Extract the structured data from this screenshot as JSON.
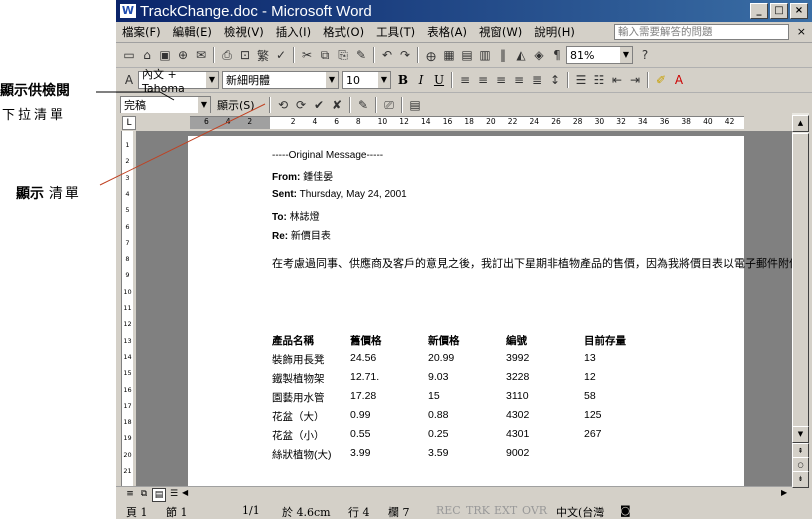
{
  "callouts": {
    "first_label": "顯示供檢閱",
    "first_sub": "下拉清單",
    "second_label": "顯示",
    "second_sub": "清單"
  },
  "window": {
    "title": "TrackChange.doc - Microsoft Word",
    "controls": [
      "_",
      "□",
      "×"
    ]
  },
  "menu": {
    "items": [
      "檔案(F)",
      "編輯(E)",
      "檢視(V)",
      "插入(I)",
      "格式(O)",
      "工具(T)",
      "表格(A)",
      "視窗(W)",
      "說明(H)"
    ],
    "help_placeholder": "輸入需要解答的問題",
    "close": "×"
  },
  "toolbar_standard": {
    "zoom": "81%",
    "icons": [
      "new-icon",
      "open-icon",
      "save-icon",
      "permission-icon",
      "email-icon",
      "print-icon",
      "print-preview-icon",
      "research-icon",
      "spelling-icon",
      "cut-icon",
      "copy-icon",
      "paste-icon",
      "format-painter-icon",
      "undo-icon",
      "redo-icon",
      "hyperlink-icon",
      "tables-icon",
      "insert-table-icon",
      "insert-excel-icon",
      "columns-icon",
      "drawing-icon",
      "document-map-icon",
      "show-hide-icon",
      "help-icon"
    ]
  },
  "toolbar_format": {
    "style": "內文 + Tahoma",
    "font": "新細明體",
    "size": "10",
    "bold": "B",
    "italic": "I",
    "underline": "U"
  },
  "toolbar_review": {
    "display": "完稿",
    "show_label": "顯示(S)"
  },
  "ruler": {
    "numbers": [
      "6",
      "4",
      "2",
      "",
      "2",
      "4",
      "6",
      "8",
      "10",
      "12",
      "14",
      "16",
      "18",
      "20",
      "22",
      "24",
      "26",
      "28",
      "30",
      "32",
      "34",
      "36",
      "38",
      "40",
      "42"
    ]
  },
  "vertical_ruler": {
    "numbers": [
      "1",
      "2",
      "3",
      "4",
      "5",
      "6",
      "7",
      "8",
      "9",
      "10",
      "11",
      "12",
      "13",
      "14",
      "15",
      "16",
      "17",
      "18",
      "19",
      "20",
      "21"
    ]
  },
  "document": {
    "original_message": "-----Original Message-----",
    "from_label": "From:",
    "from_value": "鍾佳晏",
    "sent_label": "Sent:",
    "sent_value": "Thursday, May 24, 2001",
    "to_label": "To:",
    "to_value": "林誌燈",
    "re_label": "Re:",
    "re_value": "新價目表",
    "body": "在考慮過同事、供應商及客戶的意見之後，我訂出下星期非植物產品的售價，因為我將價目表以電子郵件附件寄給您，我想也可以把產品說明及市場價格趨勢表寄給您",
    "table": {
      "headers": [
        "產品名稱",
        "舊價格",
        "新價格",
        "編號",
        "目前存量"
      ],
      "rows": [
        [
          "裝飾用長凳",
          "24.56",
          "20.99",
          "3992",
          "13"
        ],
        [
          "鐵製植物架",
          "12.71.",
          "9.03",
          "3228",
          "12"
        ],
        [
          "園藝用水管",
          "17.28",
          "15",
          "3110",
          "58"
        ],
        [
          "花盆（大）",
          "0.99",
          "0.88",
          "4302",
          "125"
        ],
        [
          "花盆（小）",
          "0.55",
          "0.25",
          "4301",
          "267"
        ],
        [
          "絲狀植物(大)",
          "3.99",
          "3.59",
          "9002",
          ""
        ]
      ]
    }
  },
  "statusbar": {
    "page": "頁 1",
    "section": "節 1",
    "pages": "1/1",
    "at": "於 4.6cm",
    "line": "行 4",
    "col": "欄 7",
    "rec": "REC",
    "trk": "TRK",
    "ext": "EXT",
    "ovr": "OVR",
    "lang": "中文(台灣"
  }
}
